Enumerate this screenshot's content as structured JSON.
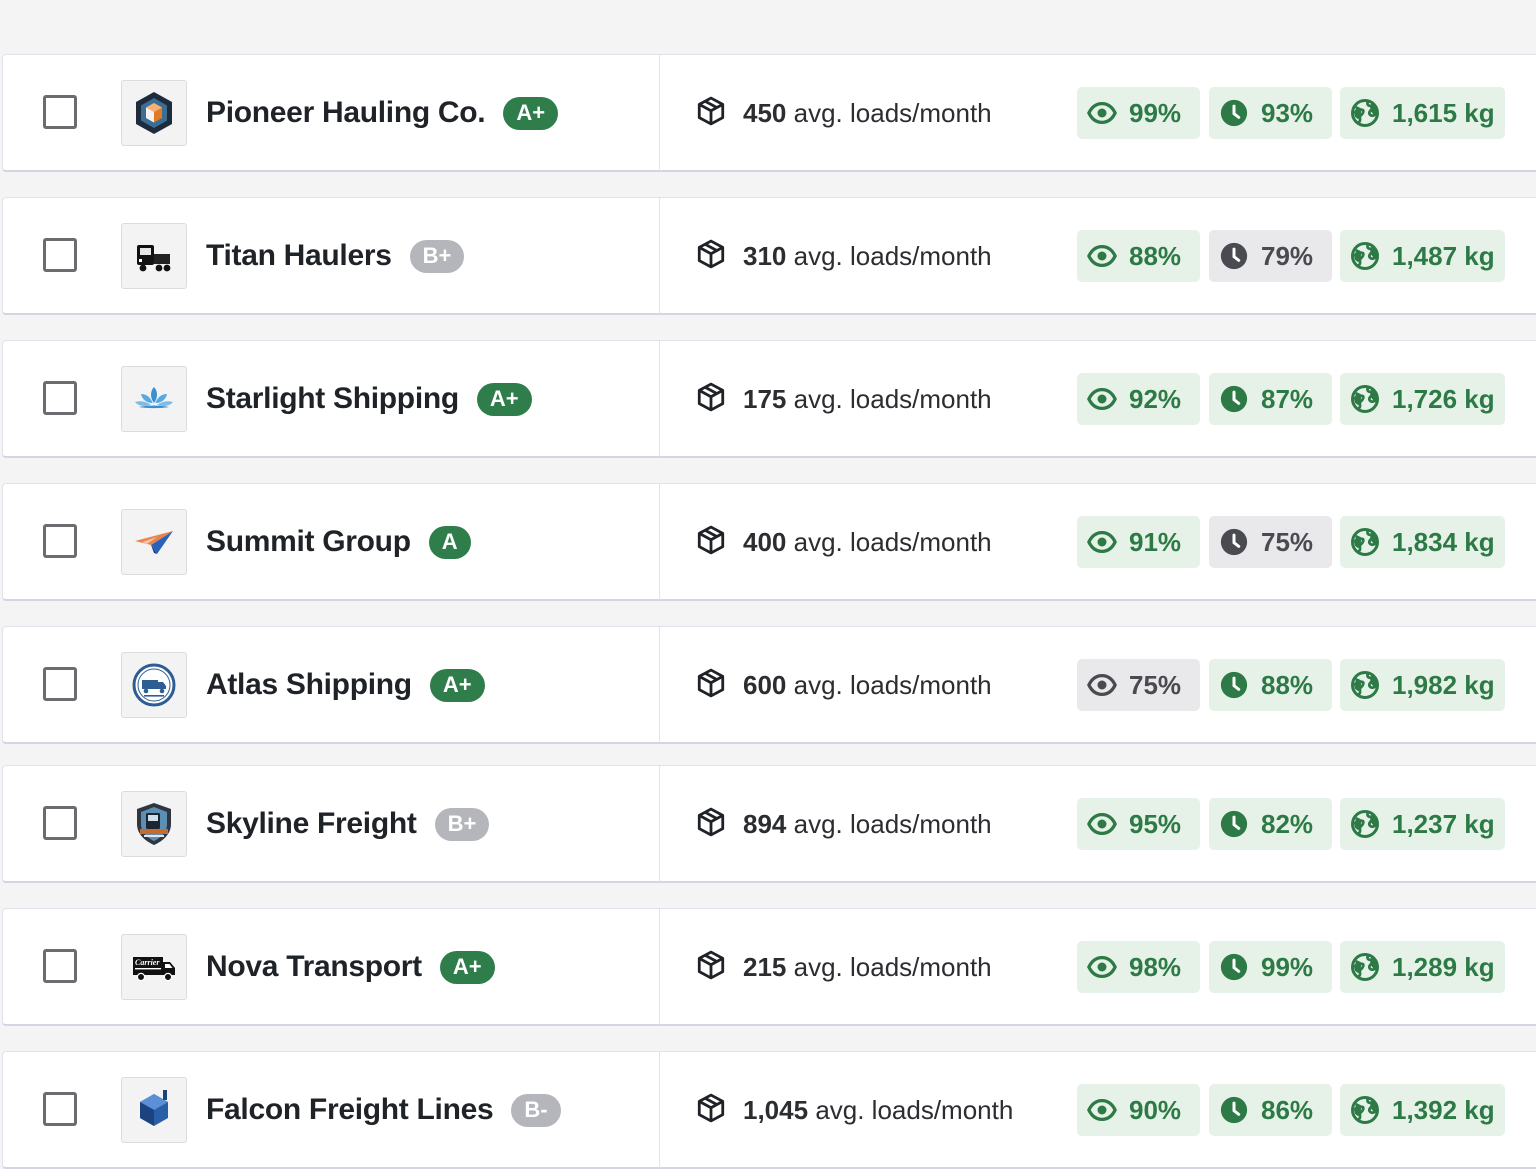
{
  "colors": {
    "grade_green": "#2f7d4a",
    "grade_gray": "#b5b6bb",
    "metric_good_bg": "#e6f2e8",
    "metric_good_text": "#2d7a46",
    "metric_neutral_bg": "#e9e9ec",
    "metric_neutral_text": "#4a4b50"
  },
  "loads_suffix": "avg. loads/month",
  "carriers": [
    {
      "name": "Pioneer Hauling Co.",
      "grade": "A+",
      "grade_status": "good",
      "logo": "hexagon-shield-logo",
      "loads": "450",
      "visibility": "99%",
      "visibility_status": "good",
      "ontime": "93%",
      "ontime_status": "good",
      "emission": "1,615 kg"
    },
    {
      "name": "Titan Haulers",
      "grade": "B+",
      "grade_status": "neutral",
      "logo": "semi-truck-logo",
      "loads": "310",
      "visibility": "88%",
      "visibility_status": "good",
      "ontime": "79%",
      "ontime_status": "neutral",
      "emission": "1,487 kg"
    },
    {
      "name": "Starlight Shipping",
      "grade": "A+",
      "grade_status": "good",
      "logo": "lotus-logo",
      "loads": "175",
      "visibility": "92%",
      "visibility_status": "good",
      "ontime": "87%",
      "ontime_status": "good",
      "emission": "1,726 kg"
    },
    {
      "name": "Summit Group",
      "grade": "A",
      "grade_status": "good",
      "logo": "paper-plane-logo",
      "loads": "400",
      "visibility": "91%",
      "visibility_status": "good",
      "ontime": "75%",
      "ontime_status": "neutral",
      "emission": "1,834 kg"
    },
    {
      "name": "Atlas Shipping",
      "grade": "A+",
      "grade_status": "good",
      "logo": "round-truck-badge-logo",
      "loads": "600",
      "visibility": "75%",
      "visibility_status": "neutral",
      "ontime": "88%",
      "ontime_status": "good",
      "emission": "1,982 kg"
    },
    {
      "name": "Skyline Freight",
      "grade": "B+",
      "grade_status": "neutral",
      "logo": "road-carriers-shield-logo",
      "loads": "894",
      "visibility": "95%",
      "visibility_status": "good",
      "ontime": "82%",
      "ontime_status": "good",
      "emission": "1,237 kg"
    },
    {
      "name": "Nova Transport",
      "grade": "A+",
      "grade_status": "good",
      "logo": "carrier-van-logo",
      "loads": "215",
      "visibility": "98%",
      "visibility_status": "good",
      "ontime": "99%",
      "ontime_status": "good",
      "emission": "1,289 kg"
    },
    {
      "name": "Falcon Freight Lines",
      "grade": "B-",
      "grade_status": "neutral",
      "logo": "blue-cube-logo",
      "loads": "1,045",
      "visibility": "90%",
      "visibility_status": "good",
      "ontime": "86%",
      "ontime_status": "good",
      "emission": "1,392 kg"
    }
  ]
}
